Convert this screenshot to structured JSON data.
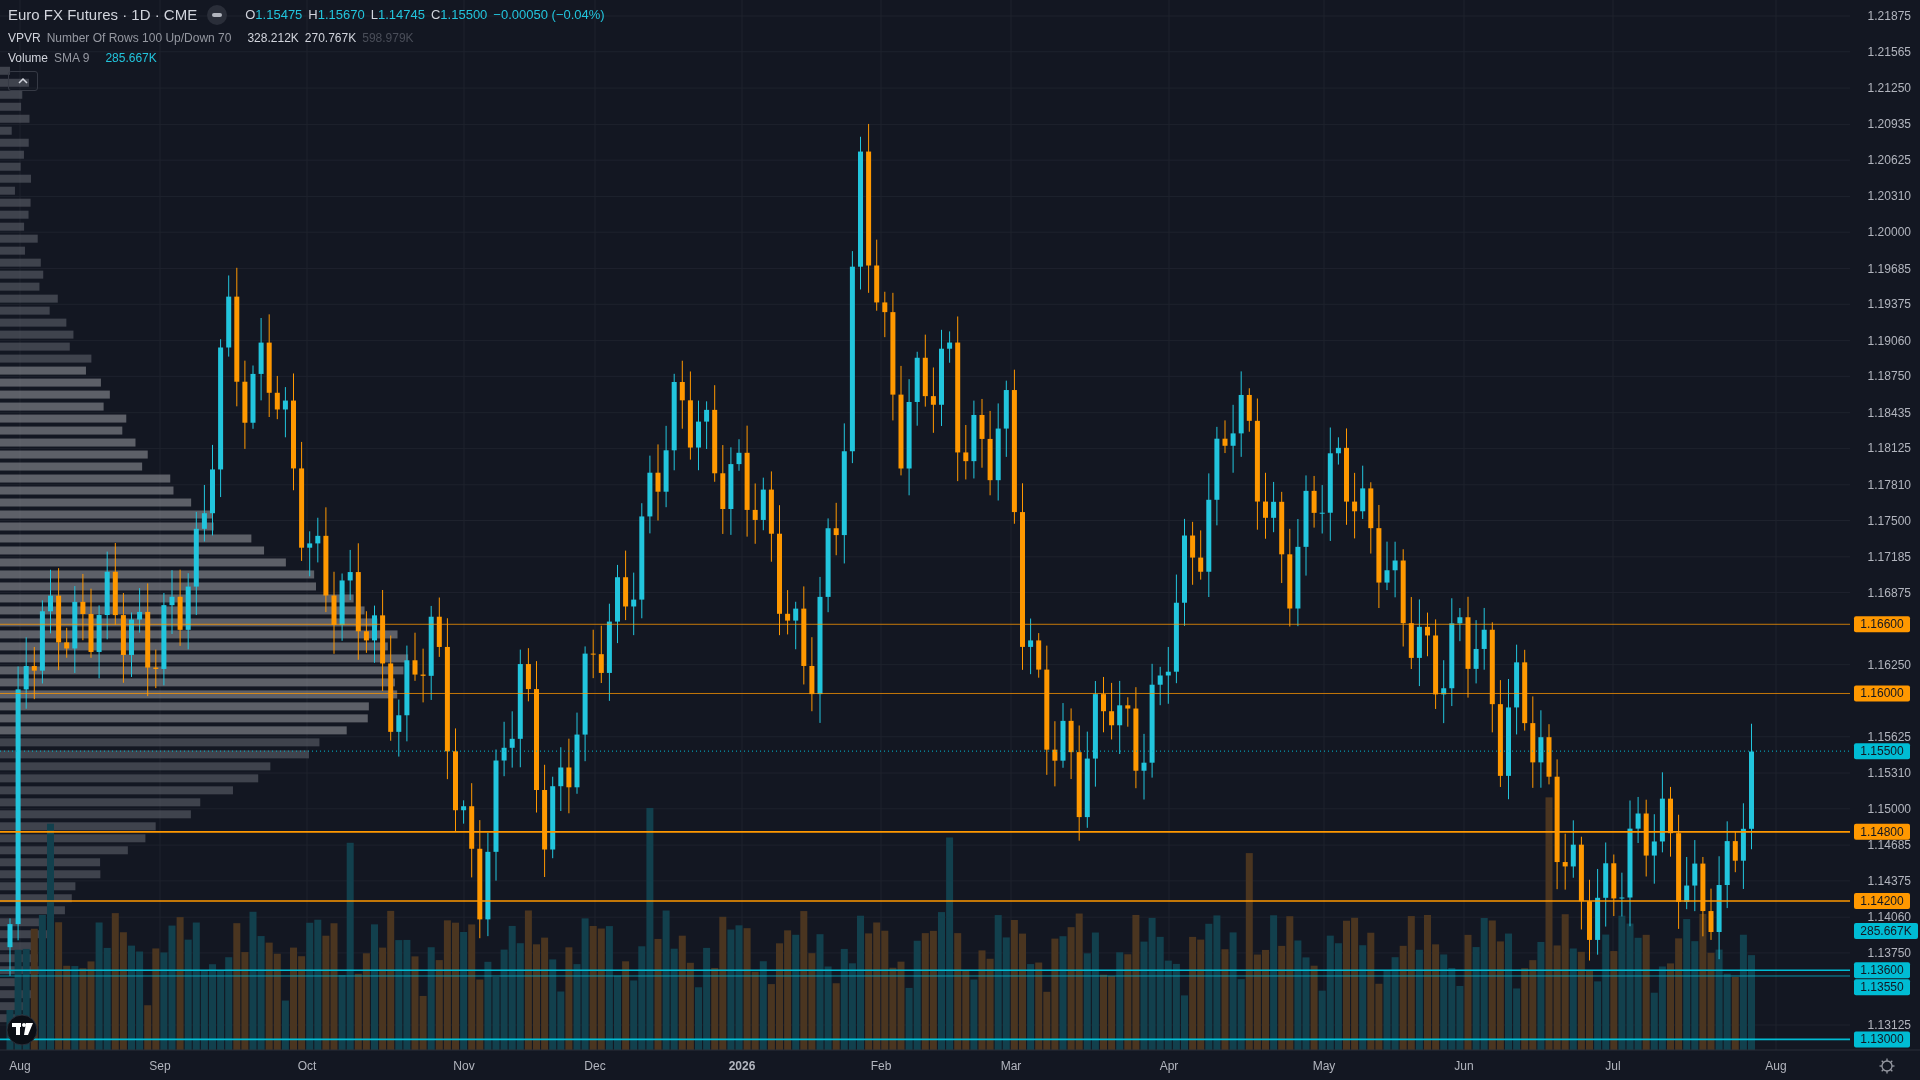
{
  "legend": {
    "symbol": "Euro FX Futures · 1D · CME",
    "ohlc": [
      {
        "label": "O",
        "value": "1.15475"
      },
      {
        "label": "H",
        "value": "1.15670"
      },
      {
        "label": "L",
        "value": "1.14745"
      },
      {
        "label": "C",
        "value": "1.15500"
      }
    ],
    "change": "−0.00050 (−0.04%)"
  },
  "indicators": [
    {
      "name": "VPVR",
      "params": "Number Of Rows 100 Up/Down 70",
      "values": [
        {
          "text": "328.212K",
          "kind": "normal"
        },
        {
          "text": "270.767K",
          "kind": "normal"
        },
        {
          "text": "598.979K",
          "kind": "muted"
        }
      ]
    },
    {
      "name": "Volume",
      "params": "SMA 9",
      "values": [
        {
          "text": "285.667K",
          "kind": "accent"
        }
      ]
    }
  ],
  "price_axis": {
    "ticks": [
      "1.21875",
      "1.21565",
      "1.21250",
      "1.20935",
      "1.20625",
      "1.20310",
      "1.20000",
      "1.19685",
      "1.19375",
      "1.19060",
      "1.18750",
      "1.18435",
      "1.18125",
      "1.17810",
      "1.17500",
      "1.17185",
      "1.16875",
      "1.16250",
      "1.15625",
      "1.15310",
      "1.15000",
      "1.14685",
      "1.14375",
      "1.14060",
      "1.13750",
      "1.13125"
    ],
    "labels": [
      {
        "text": "1.16600",
        "kind": "minor",
        "color": "#ff9800"
      },
      {
        "text": "1.16000",
        "kind": "minor",
        "color": "#ff9800"
      },
      {
        "text": "1.15500",
        "kind": "last",
        "color": "#00bcd4"
      },
      {
        "text": "1.14800",
        "kind": "major",
        "color": "#ff9800"
      },
      {
        "text": "1.14200",
        "kind": "major",
        "color": "#ff9800"
      },
      {
        "text": "285.667K",
        "kind": "indicator",
        "color": "#00bcd4"
      },
      {
        "text": "1.13600",
        "kind": "major",
        "color": "#00bcd4"
      },
      {
        "text": "1.13550",
        "kind": "minor",
        "color": "#00bcd4"
      },
      {
        "text": "1.13000",
        "kind": "major",
        "color": "#00bcd4"
      }
    ]
  },
  "time_axis": [
    {
      "text": "Aug",
      "bold": false
    },
    {
      "text": "Sep",
      "bold": false
    },
    {
      "text": "Oct",
      "bold": false
    },
    {
      "text": "Nov",
      "bold": false
    },
    {
      "text": "Dec",
      "bold": false
    },
    {
      "text": "2026",
      "bold": true
    },
    {
      "text": "Feb",
      "bold": false
    },
    {
      "text": "Mar",
      "bold": false
    },
    {
      "text": "Apr",
      "bold": false
    },
    {
      "text": "May",
      "bold": false
    },
    {
      "text": "Jun",
      "bold": false
    },
    {
      "text": "Jul",
      "bold": false
    },
    {
      "text": "Aug",
      "bold": false
    }
  ]
}
